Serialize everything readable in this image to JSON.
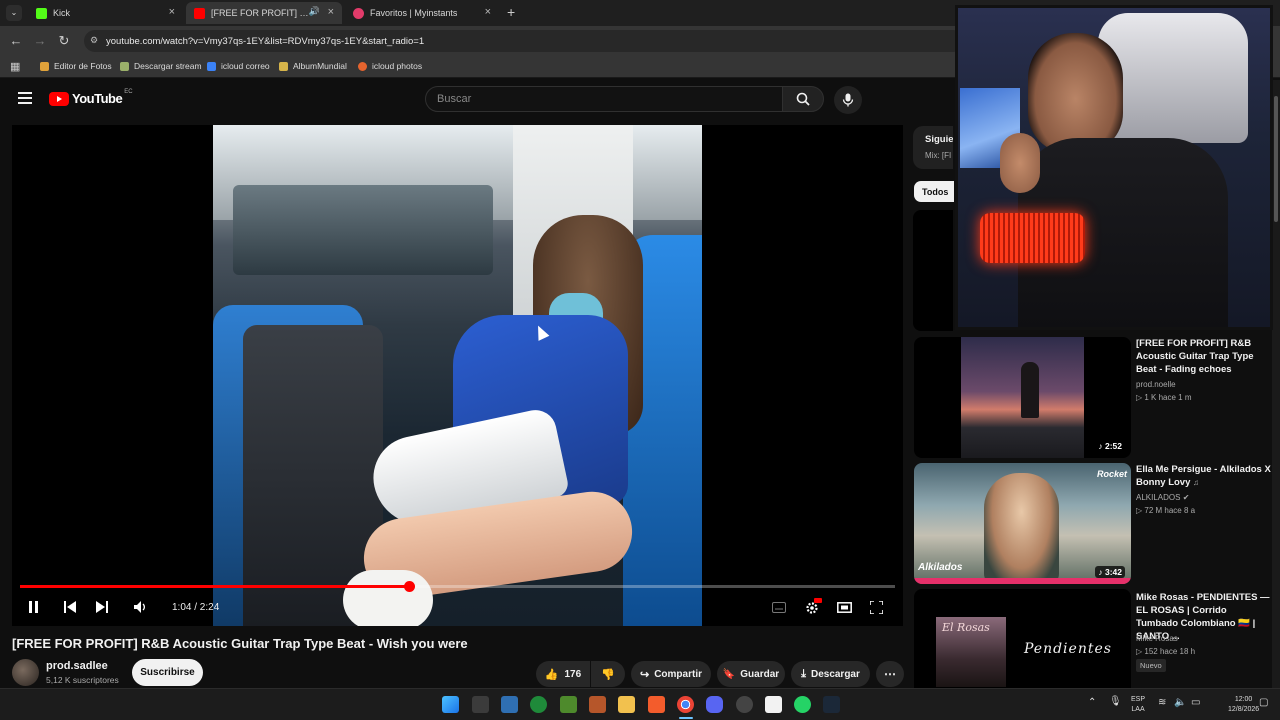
{
  "browser": {
    "tabs": [
      {
        "label": "Kick",
        "color": "#53fc18",
        "active": false
      },
      {
        "label": "[FREE FOR PROFIT] R&B Ac",
        "color": "#ff0000",
        "active": true
      },
      {
        "label": "Favoritos | Myinstants",
        "color": "#e23b6a",
        "active": false
      }
    ],
    "url": "youtube.com/watch?v=Vmy37qs-1EY&list=RDVmy37qs-1EY&start_radio=1",
    "bookmarks": [
      {
        "label": "Editor de Fotos",
        "color": "#e0a23a"
      },
      {
        "label": "Descargar stream",
        "color": "#9bb06a"
      },
      {
        "label": "icloud correo",
        "color": "#3b82f6"
      },
      {
        "label": "AlbumMundial",
        "color": "#d6b44a"
      },
      {
        "label": "icloud photos",
        "color": "#e6642e"
      }
    ]
  },
  "youtube": {
    "logo_text": "YouTube",
    "region": "EC",
    "search_placeholder": "Buscar"
  },
  "player": {
    "current_time": "1:04",
    "duration": "2:24",
    "progress": 0.444,
    "timecode": "1:04 / 2:24"
  },
  "video": {
    "title": "[FREE FOR PROFIT] R&B Acoustic Guitar Trap Type Beat - Wish you were",
    "channel": "prod.sadlee",
    "subscribers": "5,12 K suscriptores",
    "subscribe_label": "Suscribirse",
    "likes": "176",
    "share_label": "Compartir",
    "save_label": "Guardar",
    "download_label": "Descargar"
  },
  "sidebar": {
    "next_title": "Siguie",
    "next_sub": "Mix: [FI",
    "chip": "Todos",
    "items": [
      {
        "title": "[FREE FOR PROFIT] R&B Acoustic Guitar Trap Type Beat - Fading echoes",
        "channel": "prod.noelle",
        "meta": "▷ 1 K  hace 1 m",
        "duration": "2:52"
      },
      {
        "title": "Ella Me Persigue - Alkilados X Bonny Lovy",
        "channel": "ALKILADOS",
        "meta": "▷ 72 M  hace 8 a",
        "duration": "3:42",
        "thumb_label": "Rocket",
        "thumb_logo": "Alkilados"
      },
      {
        "title": "Mike Rosas - PENDIENTES — EL ROSAS | Corrido Tumbado Colombiano 🇨🇴 | SANTO ...",
        "channel": "Mike Rosas",
        "meta": "▷ 152  hace 18 h",
        "badge": "Nuevo",
        "thumb_text": "Pendientes",
        "thumb_script": "El Rosas"
      }
    ]
  },
  "taskbar": {
    "lang_top": "ESP",
    "lang_bottom": "LAA",
    "time": "12:00",
    "date": "12/8/2026"
  }
}
